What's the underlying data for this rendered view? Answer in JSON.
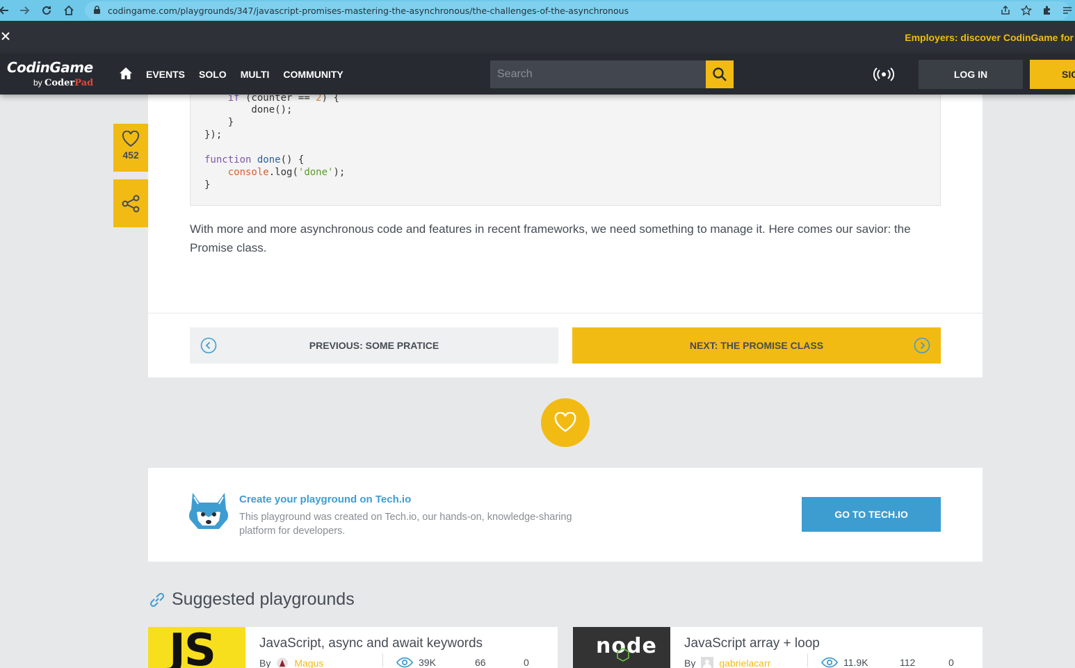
{
  "browser": {
    "url": "codingame.com/playgrounds/347/javascript-promises-mastering-the-asynchronous/the-challenges-of-the-asynchronous"
  },
  "banner": {
    "text": "Employers: discover CodinGame for"
  },
  "header": {
    "logo_main": "CodinGame",
    "logo_by": "by",
    "logo_coder": "Coder",
    "logo_pad": "Pad",
    "menu": [
      "EVENTS",
      "SOLO",
      "MULTI",
      "COMMUNITY"
    ],
    "search_placeholder": "Search",
    "login": "LOG IN",
    "signup": "SIGN UP"
  },
  "side": {
    "like_count": "452"
  },
  "code": {
    "lines": [
      "    if (counter == 2) {",
      "        done();",
      "    }",
      "});",
      "",
      "function done() {",
      "    console.log('done');",
      "}"
    ]
  },
  "content": {
    "paragraph": "With more and more asynchronous code and features in recent frameworks, we need something to manage it. Here comes our savior: the Promise class."
  },
  "pager": {
    "prev_label": "PREVIOUS: SOME PRATICE",
    "next_label": "NEXT: THE PROMISE CLASS"
  },
  "techio": {
    "title": "Create your playground on Tech.io",
    "description": "This playground was created on Tech.io, our hands-on, knowledge-sharing platform for developers.",
    "button": "GO TO TECH.IO"
  },
  "suggested": {
    "title": "Suggested playgrounds",
    "cards": [
      {
        "title": "JavaScript, async and await keywords",
        "by": "By",
        "author": "Magus",
        "views": "39K",
        "likes": "66",
        "comments": "0",
        "thumb_text": "JS"
      },
      {
        "title": "JavaScript array + loop",
        "by": "By",
        "author": "gabrielacarr",
        "views": "11.9K",
        "likes": "112",
        "comments": "0",
        "thumb_text": "node"
      }
    ]
  },
  "colors": {
    "accent": "#f2bb13",
    "header_bg": "#272b31",
    "techio_blue": "#3d9dd1"
  }
}
